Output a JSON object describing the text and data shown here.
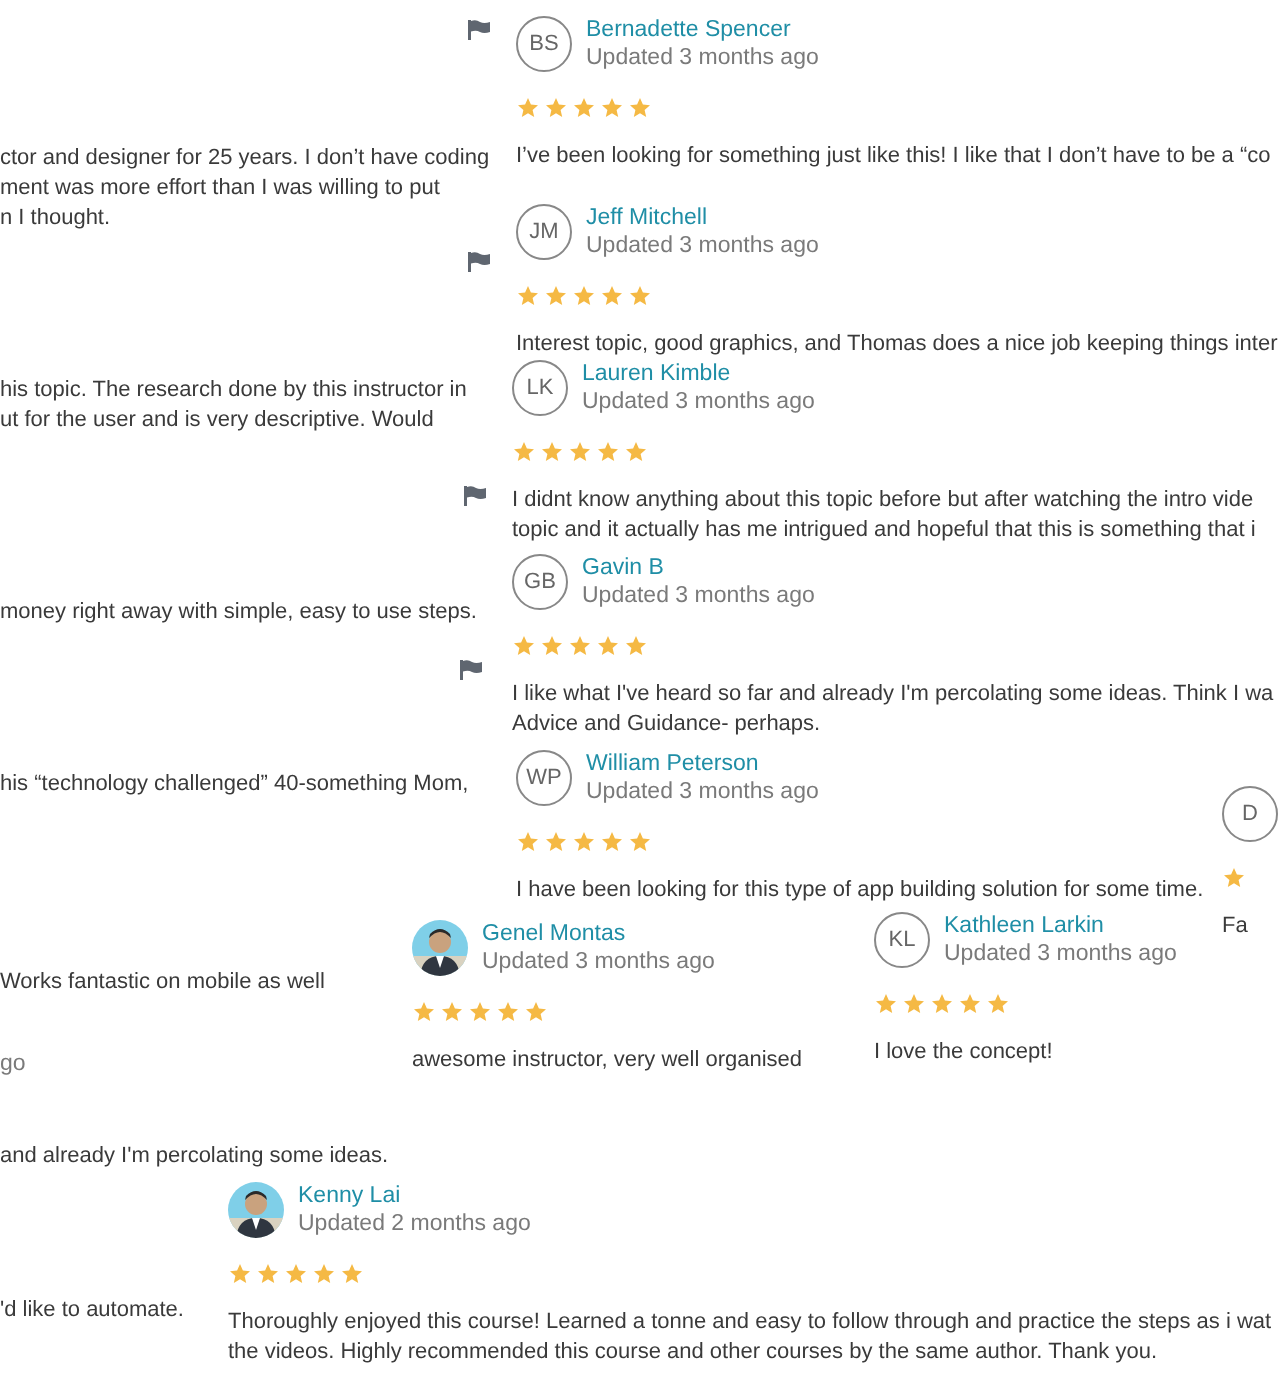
{
  "fragments": [
    {
      "lines": [
        "ctor and designer for 25 years. I don’t have coding",
        "ment was more effort than I was willing to put",
        "n I thought."
      ]
    },
    {
      "lines": [
        "his topic. The research done by this instructor in",
        "ut for the user and is very descriptive. Would"
      ]
    },
    {
      "lines": [
        "money right away with simple, easy to use steps."
      ]
    },
    {
      "lines": [
        "his “technology challenged” 40-something Mom,"
      ]
    },
    {
      "lines": [
        "Works fantastic on mobile as well"
      ]
    },
    {
      "lines": [
        "go"
      ],
      "kind": "time"
    },
    {
      "lines": [
        "and already I'm percolating some ideas."
      ]
    },
    {
      "lines": [
        "'d like to automate."
      ]
    }
  ],
  "reviews": [
    {
      "kind": "initials",
      "initials": "BS",
      "name": "Bernadette Spencer",
      "updated": "Updated 3 months ago",
      "stars": 5,
      "text": [
        "I’ve been looking for something just like this! I like that I don’t have to be a “co"
      ]
    },
    {
      "kind": "initials",
      "initials": "JM",
      "name": "Jeff Mitchell",
      "updated": "Updated 3 months ago",
      "stars": 5,
      "text": [
        "Interest topic, good graphics, and Thomas does a nice job keeping things inter"
      ]
    },
    {
      "kind": "initials",
      "initials": "LK",
      "name": "Lauren Kimble",
      "updated": "Updated 3 months ago",
      "stars": 5,
      "text": [
        "I didnt know anything about this topic before but after watching the intro vide",
        "topic and it actually has me intrigued and hopeful that this is something that i"
      ]
    },
    {
      "kind": "initials",
      "initials": "GB",
      "name": "Gavin B",
      "updated": "Updated 3 months ago",
      "stars": 5,
      "text": [
        "I like what I've heard so far and already I'm percolating some ideas. Think I wa",
        "Advice and Guidance- perhaps."
      ]
    },
    {
      "kind": "initials",
      "initials": "WP",
      "name": "William Peterson",
      "updated": "Updated 3 months ago",
      "stars": 5,
      "text": [
        "I have been looking for this type of app building solution for some time."
      ]
    },
    {
      "name": "Genel Montas",
      "updated": "Updated 3 months ago",
      "stars": 5,
      "text": [
        "awesome instructor, very well organised"
      ]
    },
    {
      "kind": "initials",
      "initials": "KL",
      "name": "Kathleen Larkin",
      "updated": "Updated 3 months ago",
      "stars": 5,
      "text": [
        "I love the concept!"
      ]
    },
    {
      "name": "Kenny Lai",
      "updated": "Updated 2 months ago",
      "stars": 5,
      "text": [
        "Thoroughly enjoyed this course! Learned a tonne and easy to follow through and practice the steps as i wat",
        "the videos. Highly recommended this course and other courses by the same author. Thank you."
      ]
    },
    {
      "kind": "partial",
      "initials": "D",
      "text": [
        "Fa"
      ]
    }
  ],
  "flags": [
    {
      "kind": "flag"
    },
    {
      "kind": "flag"
    },
    {
      "kind": "flag"
    },
    {
      "kind": "flag"
    }
  ]
}
